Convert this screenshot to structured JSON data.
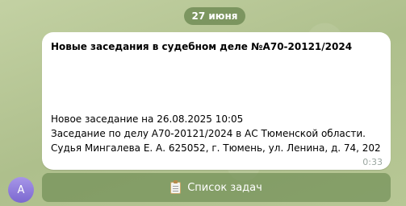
{
  "date_divider": "27 июня",
  "message": {
    "title": "Новые заседания в судебном деле №А70-20121/2024",
    "lines": [
      "Новое заседание на 26.08.2025 10:05",
      "Заседание по делу А70-20121/2024 в АС Тюменской области.",
      "Судья Мингалева Е. А.  625052, г. Тюмень, ул. Ленина, д. 74, 202"
    ],
    "time": "0:33"
  },
  "sender": {
    "avatar_letter": "A"
  },
  "keyboard": {
    "button_label": "Список задач",
    "button_icon": "clipboard-icon"
  },
  "colors": {
    "background": "#b9c99a",
    "bubble": "#ffffff",
    "avatar": "#8a78d8",
    "button": "#7d9a63"
  }
}
